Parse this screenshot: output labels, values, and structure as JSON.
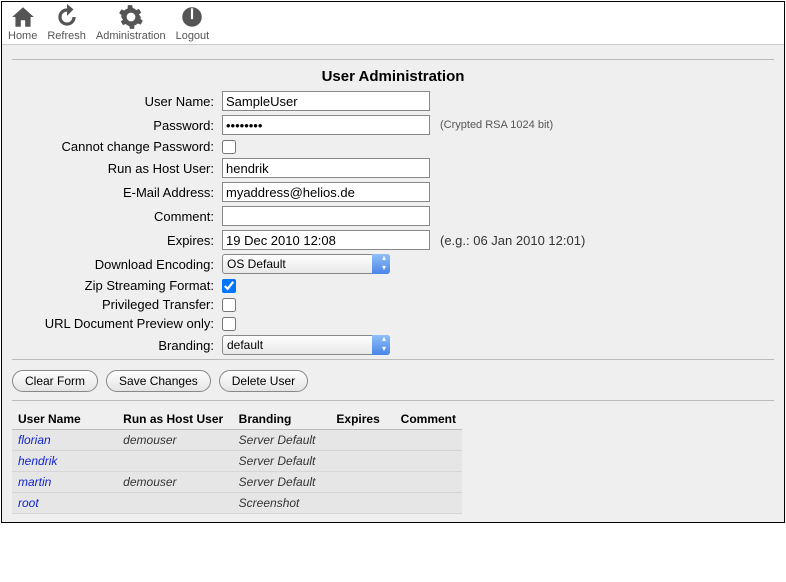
{
  "toolbar": {
    "home": "Home",
    "refresh": "Refresh",
    "admin": "Administration",
    "logout": "Logout"
  },
  "title": "User Administration",
  "labels": {
    "username": "User Name:",
    "password": "Password:",
    "cannot_change": "Cannot change Password:",
    "host_user": "Run as Host User:",
    "email": "E-Mail Address:",
    "comment": "Comment:",
    "expires": "Expires:",
    "encoding": "Download Encoding:",
    "zip_stream": "Zip Streaming Format:",
    "priv_transfer": "Privileged Transfer:",
    "url_preview": "URL Document Preview only:",
    "branding": "Branding:"
  },
  "values": {
    "username": "SampleUser",
    "password": "••••••••",
    "host_user": "hendrik",
    "email": "myaddress@helios.de",
    "comment": "",
    "expires": "19 Dec 2010 12:08",
    "encoding": "OS Default",
    "branding": "default",
    "zip_stream_checked": true,
    "cannot_change_checked": false,
    "priv_transfer_checked": false,
    "url_preview_checked": false
  },
  "hints": {
    "password": "(Crypted RSA 1024 bit)",
    "expires": "(e.g.: 06 Jan 2010 12:01)"
  },
  "buttons": {
    "clear": "Clear Form",
    "save": "Save Changes",
    "delete": "Delete User"
  },
  "table": {
    "headers": {
      "username": "User Name",
      "hostuser": "Run as Host User",
      "branding": "Branding",
      "expires": "Expires",
      "comment": "Comment"
    },
    "rows": [
      {
        "username": "florian",
        "hostuser": "demouser",
        "branding": "Server Default",
        "expires": "",
        "comment": ""
      },
      {
        "username": "hendrik",
        "hostuser": "",
        "branding": "Server Default",
        "expires": "",
        "comment": ""
      },
      {
        "username": "martin",
        "hostuser": "demouser",
        "branding": "Server Default",
        "expires": "",
        "comment": ""
      },
      {
        "username": "root",
        "hostuser": "",
        "branding": "Screenshot",
        "expires": "",
        "comment": ""
      }
    ]
  }
}
